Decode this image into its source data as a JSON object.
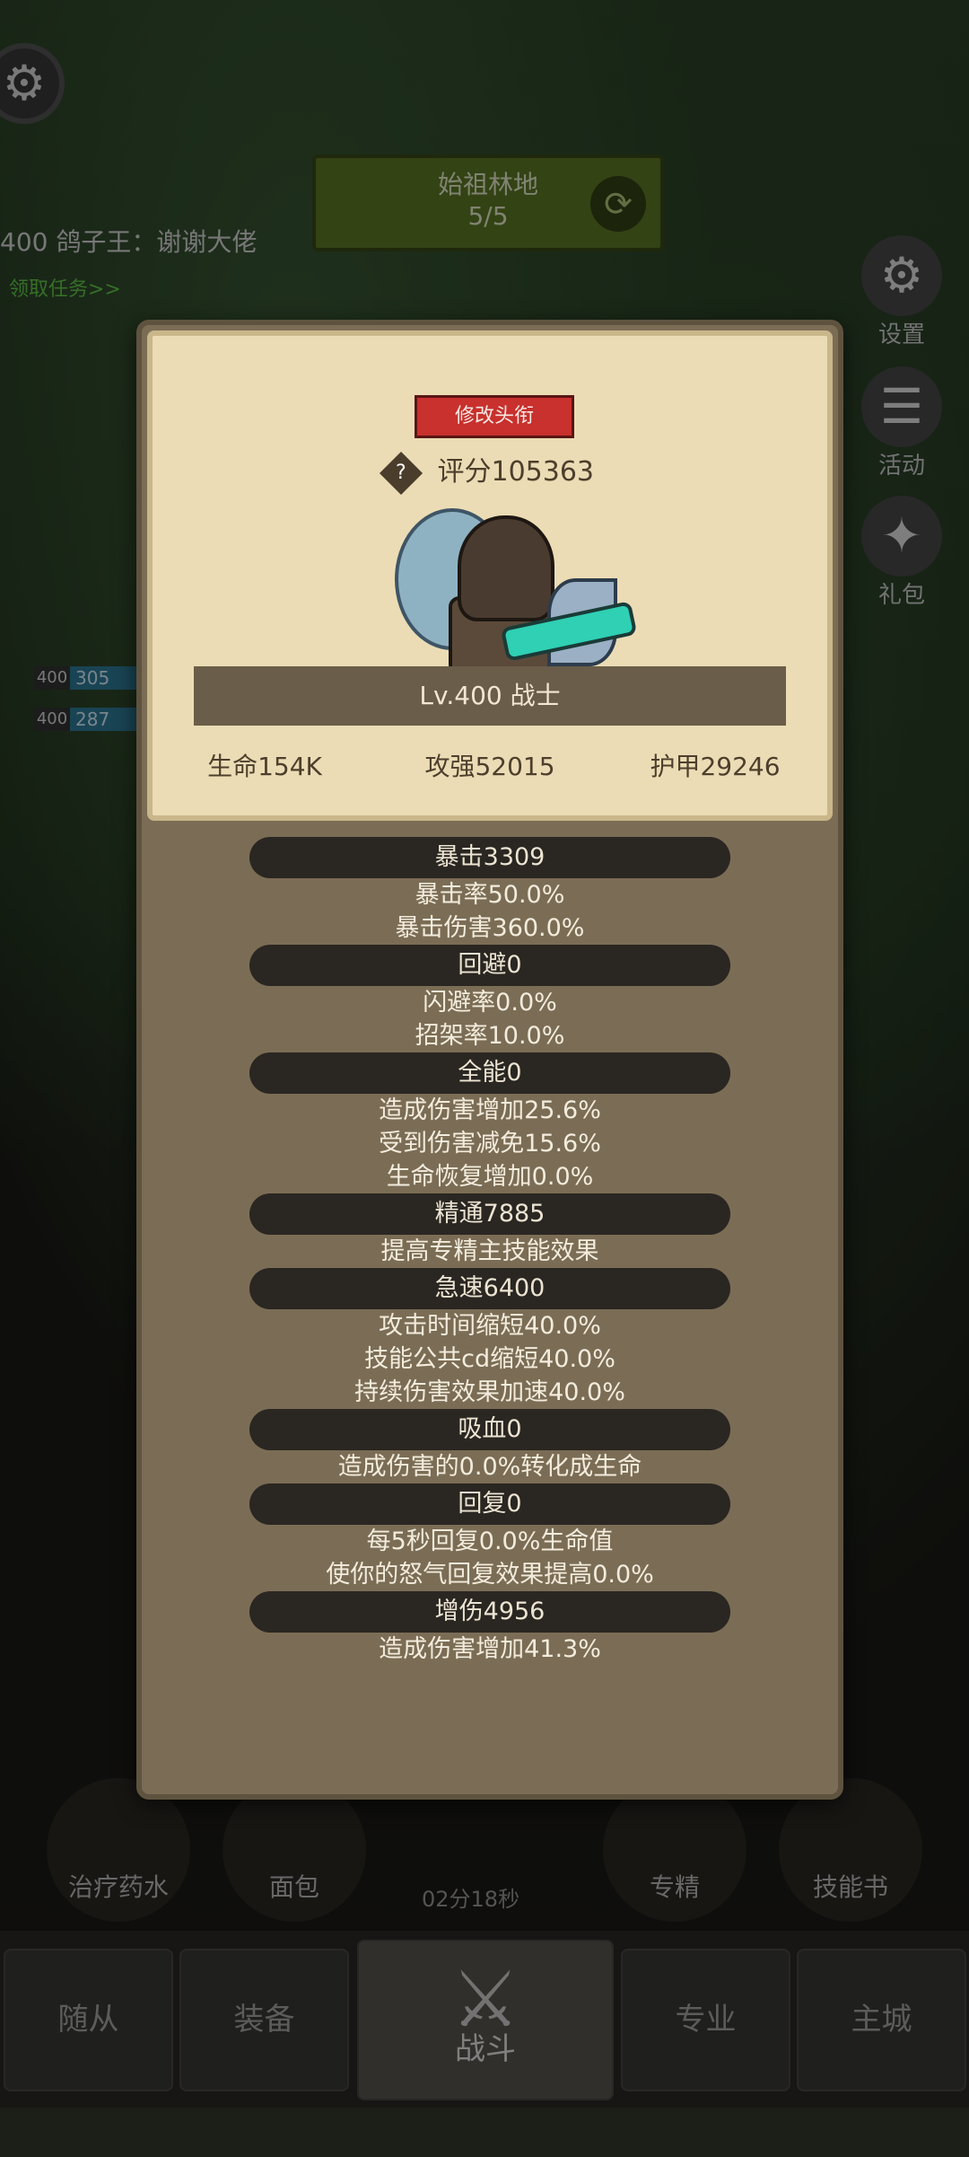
{
  "map": {
    "name": "始祖林地",
    "progress": "5/5"
  },
  "chat": {
    "message": "400 鸽子王：谢谢大佬",
    "quest_link": "领取任务>>"
  },
  "side_menu": [
    {
      "label": "设置"
    },
    {
      "label": "活动"
    },
    {
      "label": "礼包"
    }
  ],
  "party_bars": [
    {
      "level": "400",
      "value": "305"
    },
    {
      "level": "400",
      "value": "287"
    }
  ],
  "modal": {
    "rename_button": "修改头衔",
    "help_glyph": "?",
    "score": "评分105363",
    "level_class": "Lv.400 战士",
    "main_stats": {
      "hp": "生命154K",
      "attack": "攻强52015",
      "armor": "护甲29246"
    },
    "attributes": [
      {
        "header": "暴击3309",
        "lines": [
          "暴击率50.0%",
          "暴击伤害360.0%"
        ]
      },
      {
        "header": "回避0",
        "lines": [
          "闪避率0.0%",
          "招架率10.0%"
        ]
      },
      {
        "header": "全能0",
        "lines": [
          "造成伤害增加25.6%",
          "受到伤害减免15.6%",
          "生命恢复增加0.0%"
        ]
      },
      {
        "header": "精通7885",
        "lines": [
          "提高专精主技能效果"
        ]
      },
      {
        "header": "急速6400",
        "lines": [
          "攻击时间缩短40.0%",
          "技能公共cd缩短40.0%",
          "持续伤害效果加速40.0%"
        ]
      },
      {
        "header": "吸血0",
        "lines": [
          "造成伤害的0.0%转化成生命"
        ]
      },
      {
        "header": "回复0",
        "lines": [
          "每5秒回复0.0%生命值",
          "使你的怒气回复效果提高0.0%"
        ]
      },
      {
        "header": "增伤4956",
        "lines": [
          "造成伤害增加41.3%"
        ]
      }
    ]
  },
  "bottom_items": [
    {
      "label": "治疗药水"
    },
    {
      "label": "面包"
    },
    {
      "label": "专精"
    },
    {
      "label": "技能书"
    }
  ],
  "timer": "02分18秒",
  "tabs": [
    {
      "label": "随从"
    },
    {
      "label": "装备"
    },
    {
      "label": "战斗"
    },
    {
      "label": "专业"
    },
    {
      "label": "主城"
    }
  ],
  "icons": {
    "settings": "gear-icon",
    "refresh": "refresh-icon",
    "battle": "crossed-swords-icon"
  }
}
